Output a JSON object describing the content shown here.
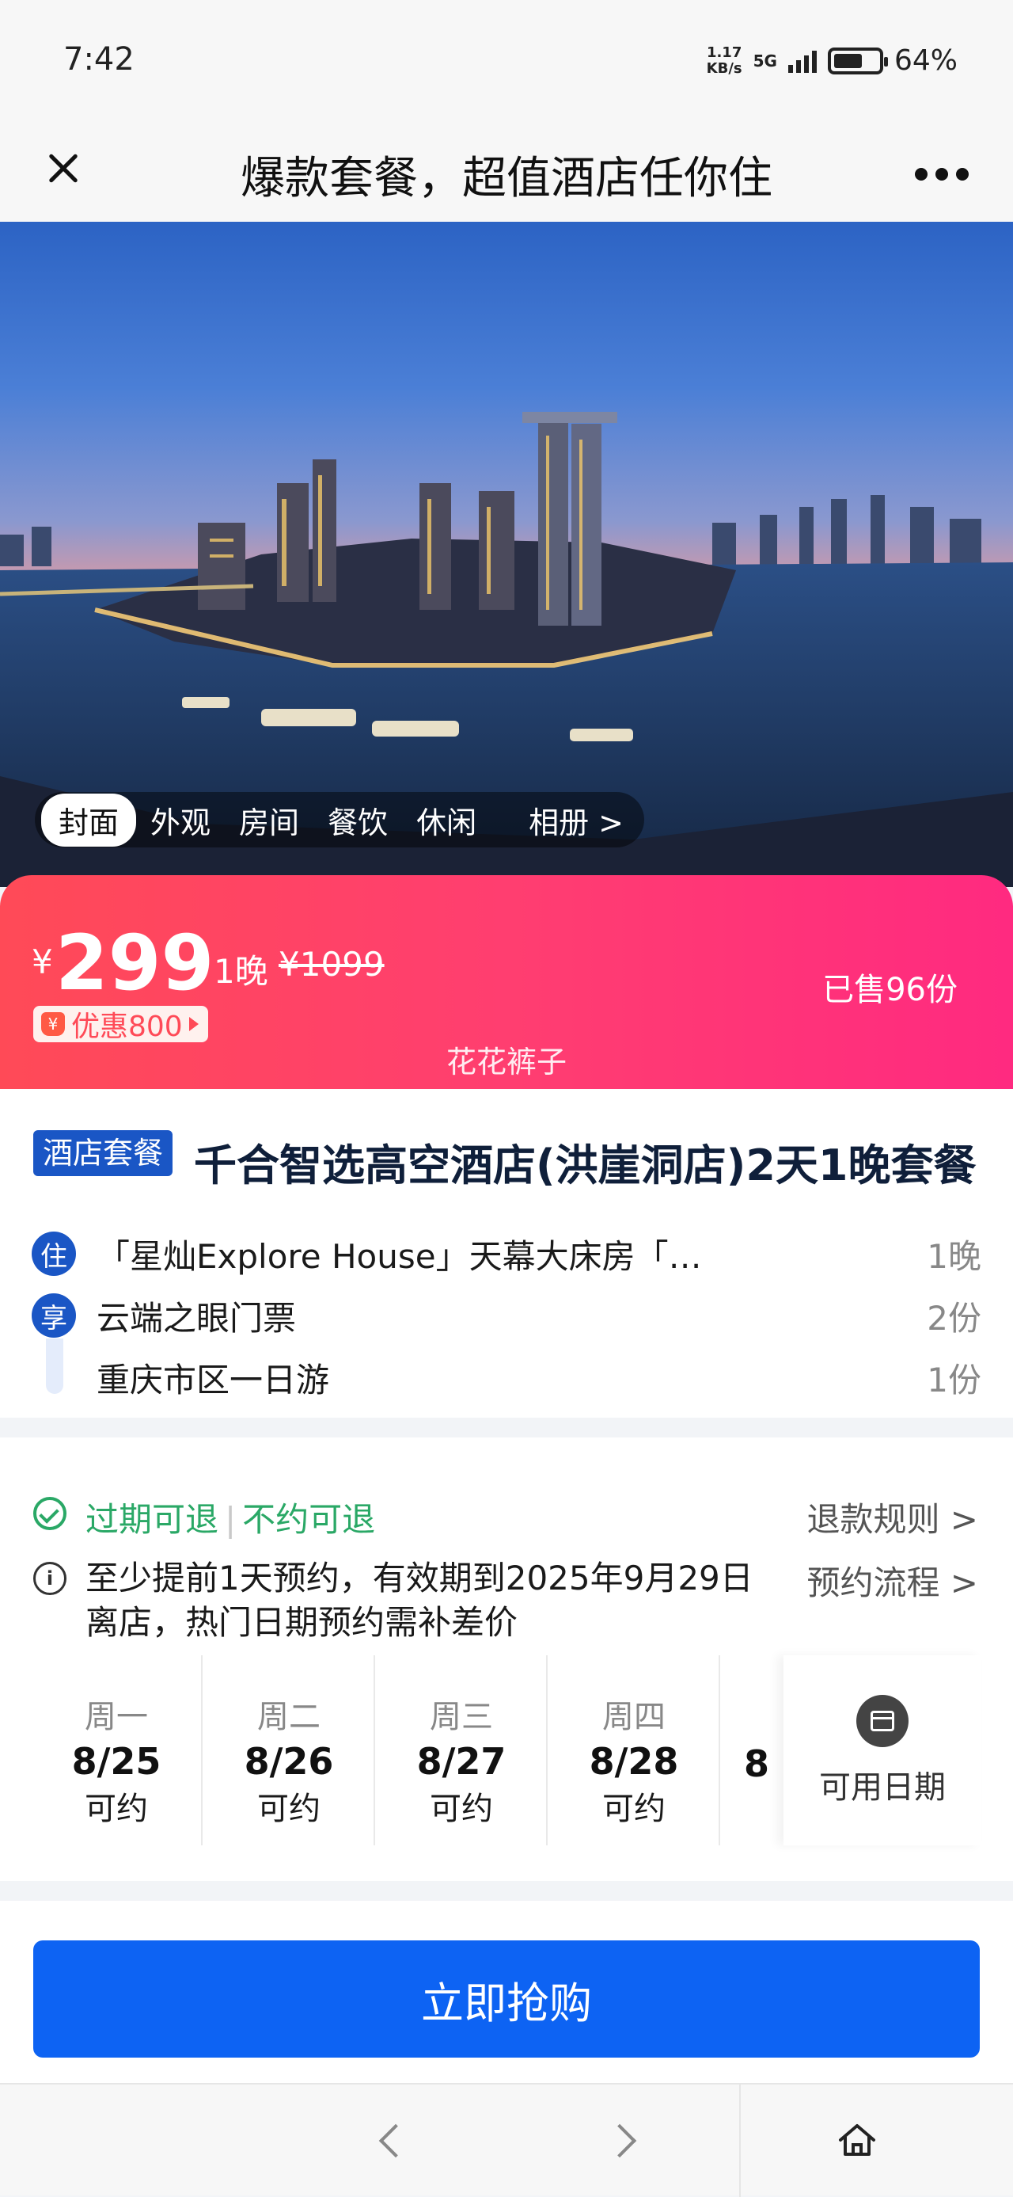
{
  "status": {
    "time": "7:42",
    "speed_top": "1.17",
    "speed_bottom": "KB/s",
    "network": "5G",
    "battery": "64%",
    "battery_level": 0.64
  },
  "header": {
    "title": "爆款套餐，超值酒店任你住"
  },
  "hero": {
    "tabs": [
      "封面",
      "外观",
      "房间",
      "餐饮",
      "休闲"
    ],
    "album_label": "相册 >"
  },
  "price": {
    "currency": "¥",
    "amount": "299",
    "nights": "1晚",
    "original": "¥1099",
    "sold": "已售96份",
    "discount": "优惠800",
    "watermark": "花花裤子"
  },
  "package": {
    "tag": "酒店套餐",
    "title": "千合智选高空酒店(洪崖洞店)2天1晚套餐",
    "items": [
      {
        "badge": "住",
        "text": "「星灿Explore House」天幕大床房「…",
        "qty": "1晚"
      },
      {
        "badge": "享",
        "text": "云端之眼门票",
        "qty": "2份"
      },
      {
        "badge": "",
        "text": "重庆市区一日游",
        "qty": "1份"
      }
    ]
  },
  "policy": {
    "refund1": "过期可退",
    "sep": "|",
    "refund2": "不约可退",
    "refund_rules": "退款规则 >",
    "booking_note": "至少提前1天预约，有效期到2025年9月29日离店，热门日期预约需补差价",
    "booking_flow": "预约流程 >"
  },
  "dates": [
    {
      "weekday": "周一",
      "day": "8/25",
      "status": "可约"
    },
    {
      "weekday": "周二",
      "day": "8/26",
      "status": "可约"
    },
    {
      "weekday": "周三",
      "day": "8/27",
      "status": "可约"
    },
    {
      "weekday": "周四",
      "day": "8/28",
      "status": "可约"
    }
  ],
  "date_partial": "8",
  "available_dates_label": "可用日期",
  "cta": {
    "buy_label": "立即抢购"
  },
  "colors": {
    "accent_blue": "#0d63f3",
    "price_red": "#ff4a57",
    "tag_blue": "#1a56c5",
    "refund_green": "#2aa866"
  }
}
